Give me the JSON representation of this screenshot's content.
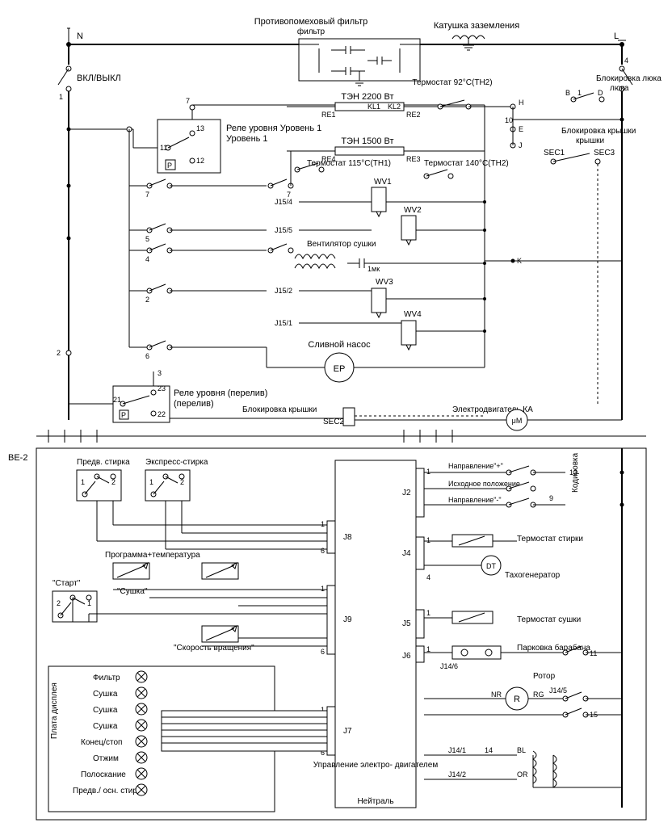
{
  "terminals": {
    "n": "N",
    "l": "L",
    "gnd": ""
  },
  "top": {
    "filter": "Противопомеховый фильтр",
    "earth_coil": "Катушка заземления",
    "onoff": "ВКЛ/ВЫКЛ",
    "door_lock": "Блокировка люка",
    "lid_lock": "Блокировка крышки",
    "lid_lock2": "Блокировка крышки",
    "sec1": "SEC1",
    "sec2": "SEC2",
    "sec3": "SEC3",
    "ka": "Электродвигатель КА"
  },
  "heaters": {
    "t2200": "ТЭН 2200 Вт",
    "kl1": "KL1",
    "kl2": "KL2",
    "re1": "RE1",
    "re2": "RE2",
    "t1500": "ТЭН 1500 Вт",
    "re3": "RE3",
    "re4": "RE4",
    "th1": "Термостат 115°C(TH1)",
    "th2_92": "Термостат 92°C(TH2)",
    "th2_140": "Термостат 140°C(TH2)"
  },
  "relays": {
    "level": "Реле уровня Уровень 1",
    "overflow": "Реле уровня (перелив)",
    "p": "P"
  },
  "valves": {
    "wv1": "WV1",
    "wv2": "WV2",
    "wv3": "WV3",
    "wv4": "WV4"
  },
  "fan": "Вентилятор сушки",
  "cap": "1мк",
  "pump": {
    "label": "Сливной насос",
    "sym": "EP"
  },
  "j_top": {
    "j154": "J15/4",
    "j155": "J15/5",
    "j152": "J15/2",
    "j151": "J15/1"
  },
  "pins_top": {
    "p1": "1",
    "p2": "2",
    "p3": "3",
    "p4": "4",
    "p5": "5",
    "p6": "6",
    "p7": "7",
    "p10": "10",
    "p11": "11",
    "p12": "12",
    "p13": "13",
    "p21": "21",
    "p22": "22",
    "p23": "23",
    "b": "B",
    "d": "D",
    "e": "E",
    "h": "H",
    "j": "J",
    "k": "K"
  },
  "be2": "BE-2",
  "buttons": {
    "prewash": "Предв. стирка",
    "express": "Экспресс-стирка",
    "start": "\"Старт\""
  },
  "knobs": {
    "prog": "Программа+температура",
    "dry": "\"Сушка\"",
    "speed": "\"Скорость вращения\""
  },
  "panel": {
    "title": "Плата дисплея",
    "items": [
      "Фильтр",
      "Сушка",
      "Сушка",
      "Сушка",
      "Конец/стоп",
      "Отжим",
      "Полоскание",
      "Предв./ осн. стирка"
    ]
  },
  "conn": {
    "j2": "J2",
    "j4": "J4",
    "j5": "J5",
    "j6": "J6",
    "j7": "J7",
    "j8": "J8",
    "j9": "J9",
    "j141": "J14/1",
    "j142": "J14/2",
    "j145": "J14/5",
    "j146": "J14/6"
  },
  "control": {
    "motor": "Управление электро- двигателем",
    "neutral": "Нейтраль"
  },
  "right": {
    "code": "Кодировка",
    "dir_plus": "Направление\"+\"",
    "home": "Исходное положение",
    "dir_minus": "Направление\"-\"",
    "wash_th": "Термостат стирки",
    "tacho": "Тахогенератор",
    "dt": "DT",
    "dry_th": "Термостат сушки",
    "park": "Парковка барабана",
    "rotor": "Ротор",
    "r": "R",
    "nr": "NR",
    "rg": "RG",
    "bl": "BL",
    "or": "OR",
    "p9": "9",
    "p11": "11",
    "p13": "13",
    "p14": "14",
    "p15": "15"
  }
}
